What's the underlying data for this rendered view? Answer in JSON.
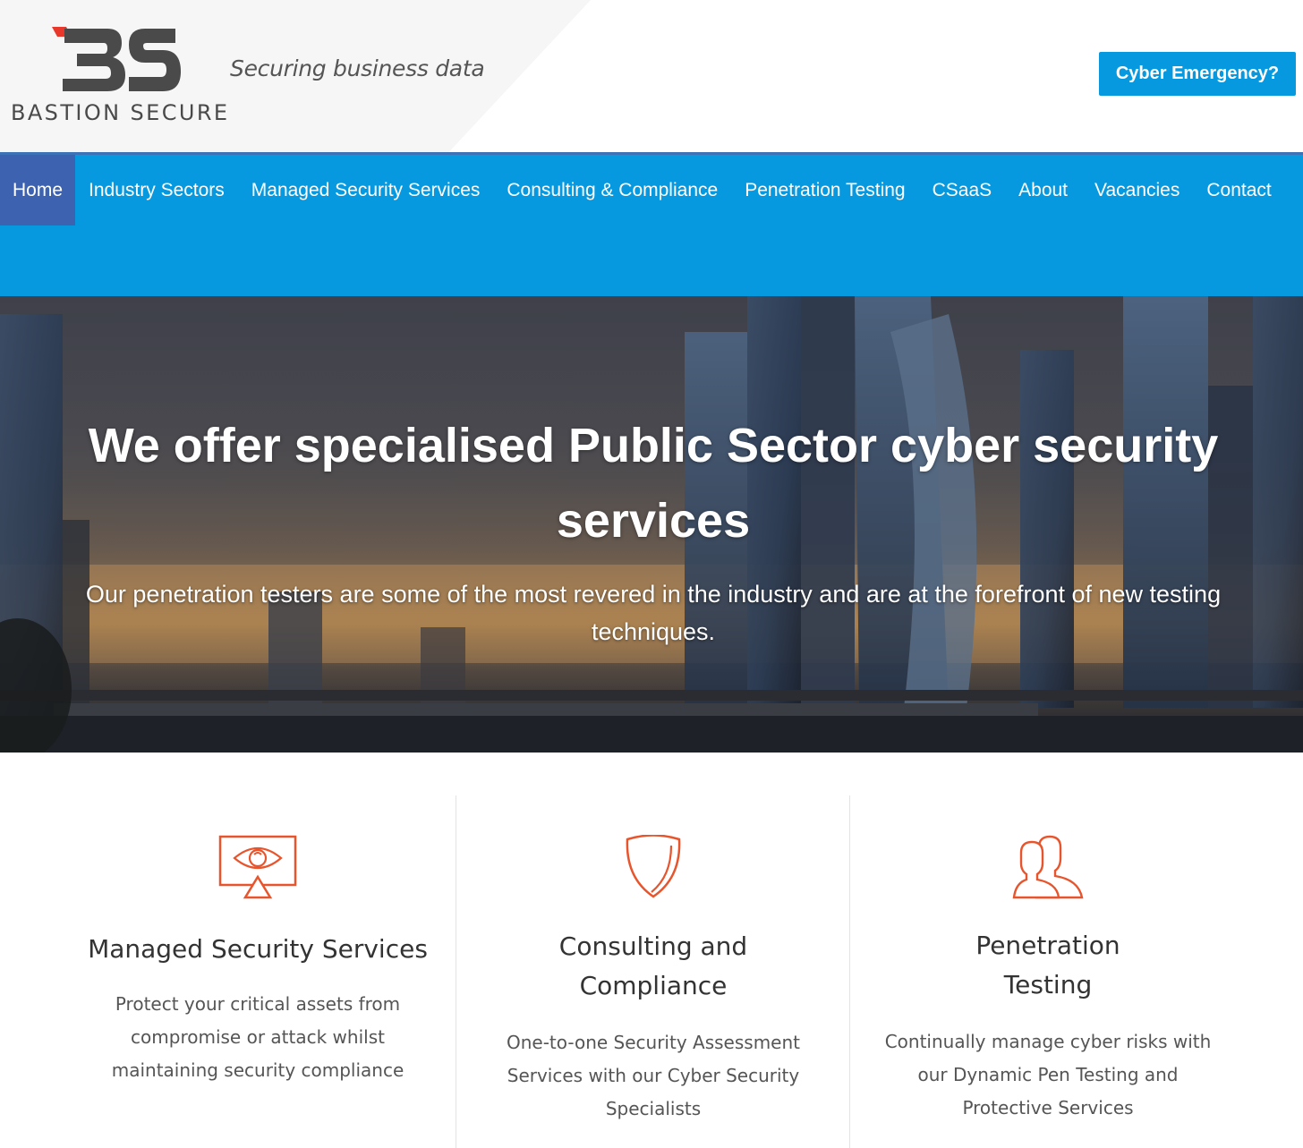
{
  "header": {
    "logo_text": "BASTION SECURE",
    "tagline": "Securing business data",
    "cta_label": "Cyber Emergency?"
  },
  "nav": {
    "items": [
      {
        "label": "Home",
        "active": true
      },
      {
        "label": "Industry Sectors"
      },
      {
        "label": "Managed Security Services"
      },
      {
        "label": "Consulting & Compliance"
      },
      {
        "label": "Penetration Testing"
      },
      {
        "label": "CSaaS"
      },
      {
        "label": "About"
      },
      {
        "label": "Vacancies"
      },
      {
        "label": "Contact"
      }
    ]
  },
  "hero": {
    "title_line1": "We offer specialised Public Sector cyber security",
    "title_line2": "services",
    "subtitle_line1": "Our penetration testers are some of the most revered in the industry and are at the forefront of new testing",
    "subtitle_line2": "techniques."
  },
  "services": [
    {
      "icon": "monitor-eye-icon",
      "title_lines": [
        "Managed Security Services"
      ],
      "text_lines": [
        "Protect your critical assets from",
        "compromise or attack whilst",
        "maintaining security compliance"
      ]
    },
    {
      "icon": "shield-icon",
      "title_lines": [
        "Consulting and",
        "Compliance"
      ],
      "text_lines": [
        "One-to-one Security Assessment",
        "Services with our Cyber Security",
        "Specialists"
      ]
    },
    {
      "icon": "users-icon",
      "title_lines": [
        "Penetration",
        "Testing"
      ],
      "text_lines": [
        "Continually manage cyber risks with",
        "our Dynamic Pen Testing and",
        "Protective Services"
      ]
    }
  ],
  "colors": {
    "brand_blue": "#0799e0",
    "nav_active": "#3d63b0",
    "icon_orange": "#e8542c",
    "logo_red": "#e8382c",
    "logo_gray": "#4a4a4a"
  }
}
